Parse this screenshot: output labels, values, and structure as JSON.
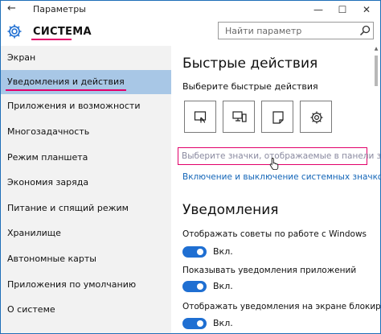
{
  "window": {
    "title": "Параметры",
    "back_glyph": "←",
    "minimize_glyph": "—",
    "maximize_glyph": "☐",
    "close_glyph": "✕"
  },
  "header": {
    "section_title": "СИСТЕМА",
    "section_icon": "gear-icon",
    "search": {
      "placeholder": "Найти параметр",
      "value": "",
      "icon": "search-icon"
    }
  },
  "sidebar": {
    "selected_index": 1,
    "items": [
      {
        "label": "Экран"
      },
      {
        "label": "Уведомления и действия"
      },
      {
        "label": "Приложения и возможности"
      },
      {
        "label": "Многозадачность"
      },
      {
        "label": "Режим планшета"
      },
      {
        "label": "Экономия заряда"
      },
      {
        "label": "Питание и спящий режим"
      },
      {
        "label": "Хранилище"
      },
      {
        "label": "Автономные карты"
      },
      {
        "label": "Приложения по умолчанию"
      },
      {
        "label": "О системе"
      }
    ]
  },
  "main": {
    "quick_actions": {
      "heading": "Быстрые действия",
      "subtitle": "Выберите быстрые действия",
      "tiles": [
        {
          "icon": "tablet-mode-icon"
        },
        {
          "icon": "connect-icon"
        },
        {
          "icon": "note-icon"
        },
        {
          "icon": "settings-icon"
        }
      ],
      "link_select_icons": "Выберите значки, отображаемые в панели задач",
      "link_system_icons": "Включение и выключение системных значков"
    },
    "notifications": {
      "heading": "Уведомления",
      "options": [
        {
          "label": "Отображать советы по работе с Windows",
          "state": "Вкл."
        },
        {
          "label": "Показывать уведомления приложений",
          "state": "Вкл."
        },
        {
          "label": "Отображать уведомления на экране блокировки",
          "state": "Вкл."
        }
      ]
    }
  },
  "colors": {
    "accent": "#1f6fd2",
    "highlight": "#e2006a",
    "selected_bg": "#a8c7e6",
    "link": "#1466b8",
    "sidebar_bg": "#f2f2f2"
  }
}
